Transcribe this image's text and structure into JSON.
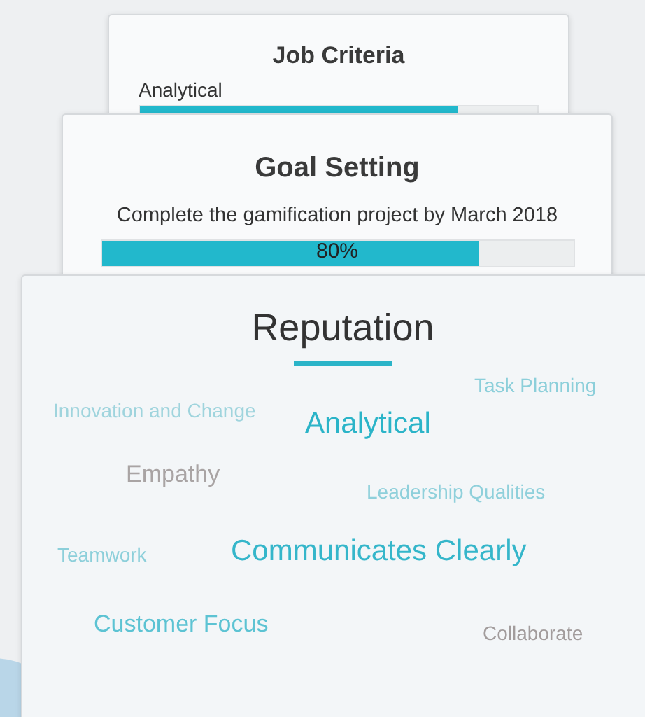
{
  "job_criteria": {
    "title": "Job Criteria",
    "label": "Analytical",
    "level": 0.8
  },
  "goal_setting": {
    "title": "Goal Setting",
    "description": "Complete the gamification project by March 2018",
    "level": 0.8,
    "reading": "80%"
  },
  "reputation": {
    "title": "Reputation",
    "words": [
      {
        "text": "Task Planning",
        "kind": "small",
        "color": "#8ccfda"
      },
      {
        "text": "Innovation and Change",
        "kind": "small",
        "color": "#9fd4dd"
      },
      {
        "text": "Analytical",
        "kind": "large",
        "color": "#2bb4c8"
      },
      {
        "text": "Empathy",
        "kind": "medium",
        "color": "#a9a4a4"
      },
      {
        "text": "Leadership Qualities",
        "kind": "small",
        "color": "#8fd0db"
      },
      {
        "text": "Teamwork",
        "kind": "small",
        "color": "#8ccfda"
      },
      {
        "text": "Communicates Clearly",
        "kind": "large",
        "color": "#35b6ca"
      },
      {
        "text": "Customer Focus",
        "kind": "medium",
        "color": "#5cc3d3"
      },
      {
        "text": "Collaborate",
        "kind": "small",
        "color": "#a29c9c"
      }
    ]
  }
}
